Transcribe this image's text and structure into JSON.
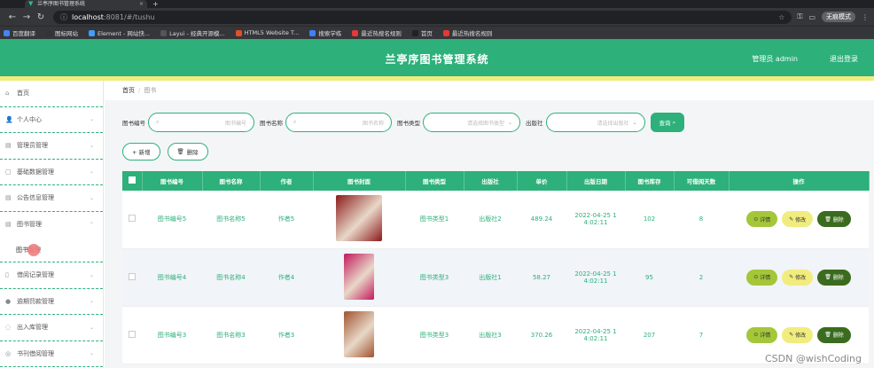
{
  "browser": {
    "tab_title": "兰亭序图书管理系统",
    "new_tab": "+",
    "url_host": "localhost",
    "url_rest": ":8081/#/tushu",
    "profile": "无痕模式",
    "bookmarks": [
      "百度翻译",
      "图标网站",
      "Element - 网站快...",
      "Layui - 经典开源模...",
      "HTML5 Website T...",
      "搜索学练",
      "最近热搜名规则",
      "首页",
      "最近热搜名规则"
    ]
  },
  "header": {
    "title": "兰亭序图书管理系统",
    "user": "管理员 admin",
    "logout": "退出登录"
  },
  "sidebar": {
    "items": [
      {
        "label": "首页",
        "icon": "⌂",
        "chev": ""
      },
      {
        "label": "个人中心",
        "icon": "👤",
        "chev": "⌄"
      },
      {
        "label": "管理员管理",
        "icon": "▤",
        "chev": "⌄"
      },
      {
        "label": "基础数据管理",
        "icon": "▢",
        "chev": "⌄"
      },
      {
        "label": "公告信息管理",
        "icon": "▤",
        "chev": "⌄"
      },
      {
        "label": "图书管理",
        "icon": "▤",
        "chev": "⌃"
      }
    ],
    "sub_item": "图书管理",
    "items2": [
      {
        "label": "借阅记录管理",
        "icon": "▯",
        "chev": "⌄"
      },
      {
        "label": "逾期罚款管理",
        "icon": "●",
        "chev": "⌄"
      },
      {
        "label": "出入库管理",
        "icon": "◌",
        "chev": "⌄"
      },
      {
        "label": "书刊借阅管理",
        "icon": "◎",
        "chev": "⌄"
      }
    ]
  },
  "breadcrumb": {
    "home": "首页",
    "sep": "/",
    "current": "图书"
  },
  "filter": {
    "book_no_label": "图书编号",
    "book_no_placeholder": "图书编号",
    "book_name_label": "图书名称",
    "book_name_placeholder": "图书名称",
    "type_label": "图书类型",
    "type_placeholder": "请选择图书类型",
    "publisher_label": "出版社",
    "publisher_placeholder": "请选择出版社",
    "query": "查询"
  },
  "actions": {
    "add": "+ 新增",
    "delete": "删除"
  },
  "table": {
    "headers": [
      "图书编号",
      "图书名称",
      "作者",
      "图书封面",
      "图书类型",
      "出版社",
      "单价",
      "出版日期",
      "图书库存",
      "可借阅天数",
      "操作"
    ],
    "rows": [
      {
        "no": "图书编号5",
        "name": "图书名称5",
        "author": "作者5",
        "type": "图书类型1",
        "publisher": "出版社2",
        "price": "489.24",
        "date1": "2022-04-25 1",
        "date2": "4:02:11",
        "stock": "102",
        "days": "8",
        "cover": "#8b1a1a"
      },
      {
        "no": "图书编号4",
        "name": "图书名称4",
        "author": "作者4",
        "type": "图书类型3",
        "publisher": "出版社1",
        "price": "58.27",
        "date1": "2022-04-25 1",
        "date2": "4:02:11",
        "stock": "95",
        "days": "2",
        "cover": "#c2185b"
      },
      {
        "no": "图书编号3",
        "name": "图书名称3",
        "author": "作者3",
        "type": "图书类型3",
        "publisher": "出版社3",
        "price": "370.26",
        "date1": "2022-04-25 1",
        "date2": "4:02:11",
        "stock": "207",
        "days": "7",
        "cover": "#a0522d"
      }
    ],
    "op_detail": "详情",
    "op_edit": "修改",
    "op_delete": "删除"
  },
  "watermark": "CSDN @wishCoding",
  "colors": {
    "primary": "#2db07a",
    "accent": "#f1ec7e",
    "danger": "#3a6b1e",
    "detail": "#a4c639"
  }
}
